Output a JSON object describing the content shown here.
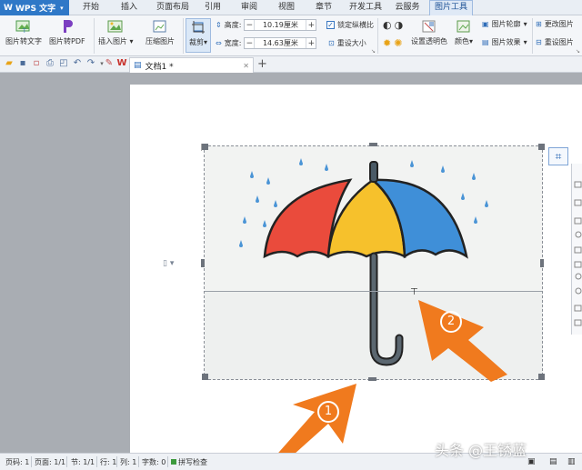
{
  "app": {
    "name": "WPS 文字"
  },
  "menu": {
    "items": [
      {
        "label": "开始"
      },
      {
        "label": "插入"
      },
      {
        "label": "页面布局"
      },
      {
        "label": "引用"
      },
      {
        "label": "审阅"
      },
      {
        "label": "视图"
      },
      {
        "label": "章节"
      },
      {
        "label": "开发工具"
      },
      {
        "label": "云服务"
      },
      {
        "label": "图片工具"
      }
    ],
    "active": "图片工具"
  },
  "ribbon": {
    "pic_to_text": "图片转文字",
    "pic_to_pdf": "图片转PDF",
    "insert_pic": "插入图片",
    "compress_pic": "压缩图片",
    "crop": "裁剪",
    "height_label": "高度:",
    "height_value": "10.19厘米",
    "width_label": "宽度:",
    "width_value": "14.63厘米",
    "lock_ratio": "锁定纵横比",
    "reset_size": "重设大小",
    "set_transparent": "设置透明色",
    "color": "颜色",
    "pic_outline": "图片轮廓",
    "pic_effect": "图片效果",
    "change_pic": "更改图片",
    "reset_pic": "重设图片"
  },
  "doc_tab": {
    "title": "文档1 *"
  },
  "status": {
    "page": "页码: 1",
    "pages": "页面: 1/1",
    "section": "节: 1/1",
    "row": "行: 1",
    "col": "列: 1",
    "words": "字数: 0",
    "spell": "拼写检查"
  },
  "annotations": {
    "marker1": "1",
    "marker2": "2",
    "arrow_color": "#f07a1e"
  },
  "watermark": "头条 @王锈蓝"
}
